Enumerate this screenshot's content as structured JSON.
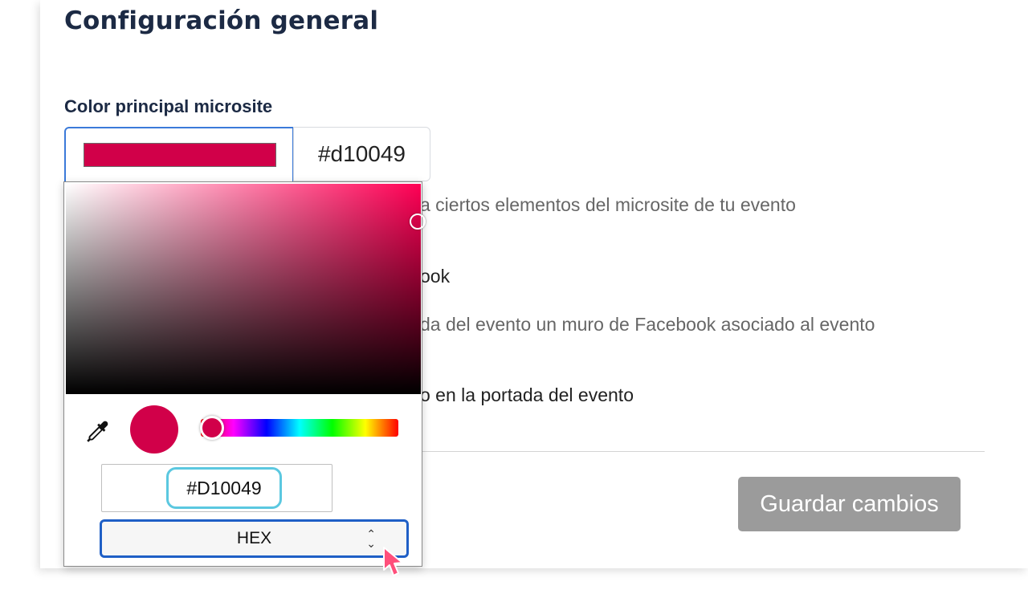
{
  "page": {
    "title": "Configuración general"
  },
  "color_setting": {
    "label": "Color principal microsite",
    "hex_value": "#d10049",
    "swatch_color": "#d10049",
    "help_text_fragment": "a ciertos elementos del microsite de tu evento"
  },
  "background_fragments": {
    "facebook_title_fragment": "ook",
    "facebook_help_fragment": "da del evento un muro de Facebook asociado al evento",
    "portada_fragment": "o en la portada del evento"
  },
  "picker": {
    "hue_color": "#ff0055",
    "saturation_pct": 99,
    "value_pct": 82,
    "hue_degrees": 340,
    "preview_color": "#d10049",
    "hex_input_value": "#D10049",
    "mode_label": "HEX",
    "mode_arrow": "⌃⌄",
    "eyedropper_icon": "eyedropper-icon"
  },
  "actions": {
    "save_label": "Guardar cambios"
  },
  "colors": {
    "title": "#1c2a44",
    "focus_border": "#3b7ad9",
    "hex_focus": "#5bc8e0",
    "select_border": "#1f5fc6",
    "save_button": "#9b9b9b",
    "cursor": "#ff4f7b"
  }
}
